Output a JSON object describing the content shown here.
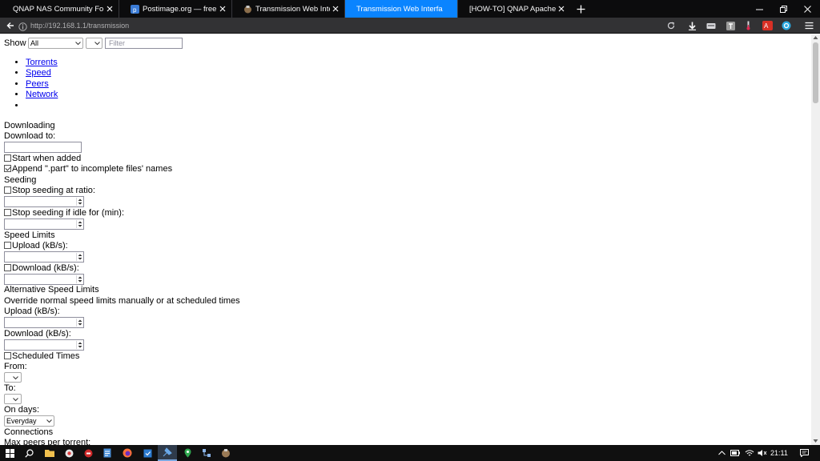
{
  "browser": {
    "tabs": [
      {
        "title": "QNAP NAS Community Forum - ",
        "icon": "forum-icon",
        "selected": false
      },
      {
        "title": "Postimage.org — free imag",
        "icon": "postimage-icon",
        "selected": false
      },
      {
        "title": "Transmission Web Interface",
        "icon": "transmission-icon",
        "selected": false
      },
      {
        "title": "Transmission Web Interface",
        "icon": "none",
        "selected": true
      },
      {
        "title": "[HOW-TO] QNAP Apache Rever",
        "icon": "none",
        "selected": false
      }
    ],
    "url": "http://192.168.1.1/transmission"
  },
  "filterbar": {
    "show_label": "Show",
    "show_value": "All",
    "filter_placeholder": "Filter"
  },
  "nav_links": [
    "Torrents",
    "Speed",
    "Peers",
    "Network",
    ""
  ],
  "downloading": {
    "heading": "Downloading",
    "download_to_label": "Download to:",
    "start_when_added": "Start when added",
    "append_part": "Append \".part\" to incomplete files' names"
  },
  "seeding": {
    "heading": "Seeding",
    "stop_ratio": "Stop seeding at ratio:",
    "stop_idle": "Stop seeding if idle for (min):"
  },
  "speed_limits": {
    "heading": "Speed Limits",
    "upload": "Upload (kB/s):",
    "download": "Download (kB/s):"
  },
  "alt_speed": {
    "heading": "Alternative Speed Limits",
    "description": "Override normal speed limits manually or at scheduled times",
    "upload": "Upload (kB/s):",
    "download": "Download (kB/s):",
    "scheduled": "Scheduled Times",
    "from": "From:",
    "to": "To:",
    "on_days": "On days:",
    "on_days_value": "Everyday"
  },
  "connections": {
    "heading": "Connections",
    "max_peers": "Max peers per torrent:"
  },
  "taskbar": {
    "time": "21:11"
  },
  "colors": {
    "selected_tab": "#0a84ff",
    "tabbar_bg": "#0c0c0d",
    "navbar_bg": "#323234",
    "link": "#0000ee",
    "taskbar_bg": "#101010"
  }
}
